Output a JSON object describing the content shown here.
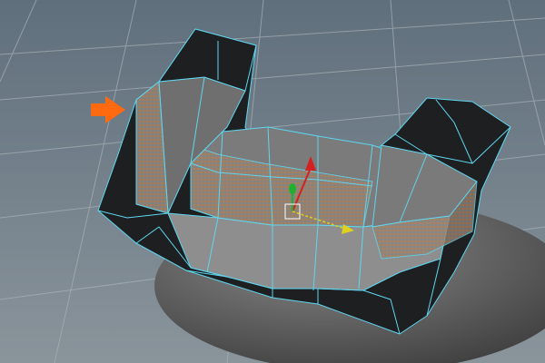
{
  "viewport": {
    "background_top": "#5f6f7c",
    "background_bottom": "#8a949b",
    "grid_color": "#a9b1b7",
    "mesh_dark": "#1e1f21",
    "mesh_face": "#7b7b7b",
    "mesh_face_light": "#939393",
    "edge_color": "#5fd6f0",
    "selection_color": "#d97a30",
    "base_object": "#4e4e4e",
    "arrow_color": "#ff6a10",
    "gizmo_y": "#d42020",
    "gizmo_z": "#20b030",
    "gizmo_x": "#e0d020",
    "icons": [
      "arrow-annotation-icon",
      "move-manipulator-icon"
    ]
  }
}
